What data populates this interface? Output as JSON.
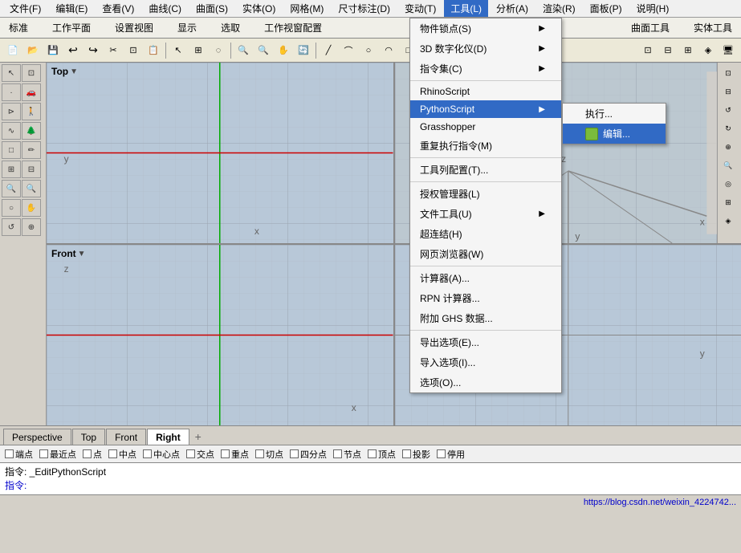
{
  "menubar": {
    "items": [
      {
        "label": "文件(F)"
      },
      {
        "label": "编辑(E)"
      },
      {
        "label": "查看(V)"
      },
      {
        "label": "曲线(C)"
      },
      {
        "label": "曲面(S)"
      },
      {
        "label": "实体(O)"
      },
      {
        "label": "网格(M)"
      },
      {
        "label": "尺寸标注(D)"
      },
      {
        "label": "变动(T)"
      },
      {
        "label": "工具(L)",
        "active": true
      },
      {
        "label": "分析(A)"
      },
      {
        "label": "渲染(R)"
      },
      {
        "label": "面板(P)"
      },
      {
        "label": "说明(H)"
      }
    ]
  },
  "toolbar_row1": {
    "label1": "标准",
    "label2": "工作平面",
    "label3": "设置视图",
    "label4": "显示",
    "label5": "选取",
    "label6": "工作视窗配置",
    "label7": "曲面工具",
    "label8": "实体工具"
  },
  "tool_menu": {
    "title": "工具(L)",
    "items": [
      {
        "label": "物件锁点(S)",
        "has_submenu": true
      },
      {
        "label": "3D 数字化仪(D)",
        "has_submenu": true
      },
      {
        "label": "指令集(C)",
        "has_submenu": true
      },
      {
        "separator": true
      },
      {
        "label": "RhinoScript",
        "has_submenu": false
      },
      {
        "label": "PythonScript",
        "has_submenu": true,
        "highlighted": true
      },
      {
        "label": "Grasshopper",
        "has_submenu": false
      },
      {
        "label": "重复执行指令(M)",
        "has_submenu": false
      },
      {
        "separator": true
      },
      {
        "label": "工具列配置(T)...",
        "has_submenu": false
      },
      {
        "separator": true
      },
      {
        "label": "授权管理器(L)",
        "has_submenu": false
      },
      {
        "label": "文件工具(U)",
        "has_submenu": true
      },
      {
        "label": "超连结(H)",
        "has_submenu": false
      },
      {
        "label": "网页浏览器(W)",
        "has_submenu": false
      },
      {
        "separator": true
      },
      {
        "label": "计算器(A)...",
        "has_submenu": false
      },
      {
        "label": "RPN 计算器...",
        "has_submenu": false
      },
      {
        "label": "附加 GHS 数据...",
        "has_submenu": false
      },
      {
        "separator": true
      },
      {
        "label": "导出选项(E)...",
        "has_submenu": false
      },
      {
        "label": "导入选项(I)...",
        "has_submenu": false
      },
      {
        "label": "选项(O)...",
        "has_submenu": false
      }
    ]
  },
  "pythonscript_submenu": {
    "items": [
      {
        "label": "执行...",
        "icon": ""
      },
      {
        "label": "编辑...",
        "icon": "grasshopper",
        "highlighted": true
      }
    ]
  },
  "viewports": {
    "top": {
      "label": "Top"
    },
    "front": {
      "label": "Front"
    },
    "right": {
      "label": "Right"
    },
    "perspective": {
      "label": "Perspective"
    }
  },
  "tabs": [
    {
      "label": "Perspective",
      "active": false
    },
    {
      "label": "Top",
      "active": false
    },
    {
      "label": "Front",
      "active": false
    },
    {
      "label": "Right",
      "active": false
    }
  ],
  "snap_items": [
    "端点",
    "最近点",
    "点",
    "中点",
    "中心点",
    "交点",
    "重点",
    "切点",
    "四分点",
    "节点",
    "顶点",
    "投影",
    "停用"
  ],
  "command": {
    "line1": "指令: _EditPythonScript",
    "line2": "指令:"
  },
  "status_bar": {
    "text": "https://blog.csdn.net/weixin_4224742..."
  }
}
